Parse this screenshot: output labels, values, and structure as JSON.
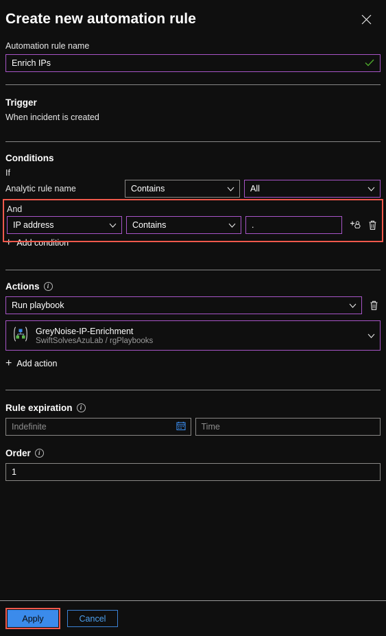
{
  "header": {
    "title": "Create new automation rule",
    "close_icon": "close-icon"
  },
  "rule_name": {
    "label": "Automation rule name",
    "value": "Enrich IPs",
    "valid_icon": "check-icon"
  },
  "trigger": {
    "title": "Trigger",
    "value": "When incident is created"
  },
  "conditions": {
    "title": "Conditions",
    "if_label": "If",
    "and_label": "And",
    "rows": [
      {
        "property": "Analytic rule name",
        "operator": "Contains",
        "value": "All",
        "property_is_static": true
      },
      {
        "property": "IP address",
        "operator": "Contains",
        "value": ".",
        "property_is_static": false
      }
    ],
    "add_label": "Add condition",
    "add_icon": "plus-icon",
    "add_value_icon": "add-entity-icon",
    "delete_icon": "trash-icon"
  },
  "actions": {
    "title": "Actions",
    "info_icon": "info-icon",
    "action_type": "Run playbook",
    "delete_icon": "trash-icon",
    "playbook": {
      "icon": "logic-app-icon",
      "name": "GreyNoise-IP-Enrichment",
      "scope": "SwiftSolvesAzuLab / rgPlaybooks"
    },
    "add_label": "Add action",
    "add_icon": "plus-icon"
  },
  "expiration": {
    "title": "Rule expiration",
    "info_icon": "info-icon",
    "date_placeholder": "Indefinite",
    "date_value": "",
    "calendar_icon": "calendar-icon",
    "time_placeholder": "Time",
    "time_value": ""
  },
  "order": {
    "title": "Order",
    "info_icon": "info-icon",
    "value": "1"
  },
  "footer": {
    "apply_label": "Apply",
    "cancel_label": "Cancel"
  },
  "colors": {
    "background": "#0f0f0f",
    "accent_focus": "#a855c8",
    "highlight": "#f0594c",
    "primary_button": "#3b8beb",
    "link": "#4ea1f0",
    "valid_check": "#4ea82b"
  }
}
